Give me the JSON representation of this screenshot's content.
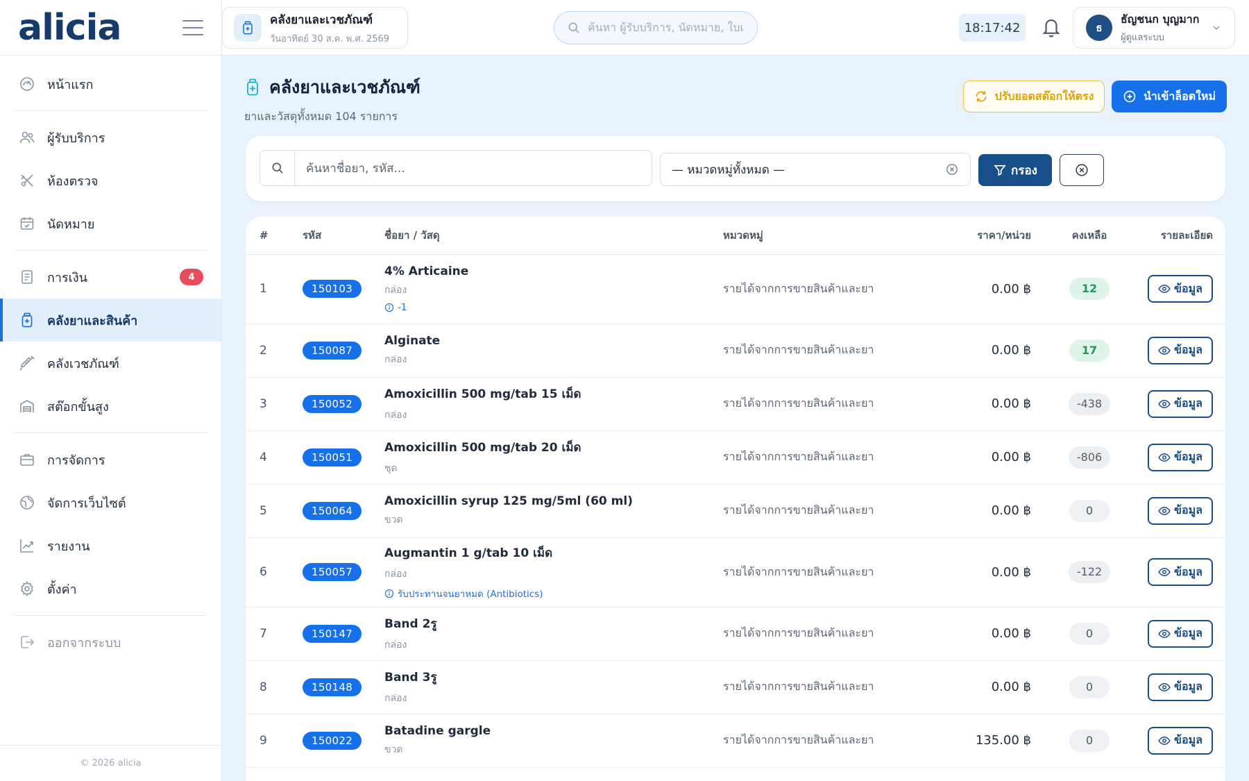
{
  "brand": {
    "logo": "alicia"
  },
  "sidebar": {
    "items": [
      {
        "id": "home",
        "label": "หน้าแรก",
        "icon": "dashboard-icon"
      },
      {
        "id": "patients",
        "label": "ผู้รับบริการ",
        "icon": "users-icon"
      },
      {
        "id": "exam-room",
        "label": "ห้องตรวจ",
        "icon": "tools-icon"
      },
      {
        "id": "appointments",
        "label": "นัดหมาย",
        "icon": "calendar-icon"
      },
      {
        "id": "finance",
        "label": "การเงิน",
        "icon": "receipt-icon",
        "badge": "4"
      },
      {
        "id": "pharmacy",
        "label": "คลังยาและสินค้า",
        "icon": "medicine-bottle-icon",
        "active": true
      },
      {
        "id": "supplies",
        "label": "คลังเวชภัณฑ์",
        "icon": "syringe-icon"
      },
      {
        "id": "advanced-stock",
        "label": "สต๊อกขั้นสูง",
        "icon": "warehouse-icon"
      },
      {
        "id": "management",
        "label": "การจัดการ",
        "icon": "briefcase-icon"
      },
      {
        "id": "website",
        "label": "จัดการเว็บไซต์",
        "icon": "globe-icon"
      },
      {
        "id": "reports",
        "label": "รายงาน",
        "icon": "chart-icon"
      },
      {
        "id": "settings",
        "label": "ตั้งค่า",
        "icon": "gear-icon"
      },
      {
        "id": "logout",
        "label": "ออกจากระบบ",
        "icon": "logout-icon"
      }
    ],
    "footer": "© 2026 alicia"
  },
  "topbar": {
    "page_chip_title": "คลังยาและเวชภัณฑ์",
    "page_chip_date": "วันอาทิตย์ 30 ส.ค. พ.ศ. 2569",
    "search_placeholder": "ค้นหา ผู้รับบริการ, นัดหมาย, ใบเสร็จ...",
    "clock": "18:17:42",
    "user_initial": "ธ",
    "user_name": "ธัญชนก บุญมาก",
    "user_role": "ผู้ดูแลระบบ"
  },
  "page": {
    "title": "คลังยาและเวชภัณฑ์",
    "subtitle": "ยาและวัสดุทั้งหมด 104 รายการ",
    "reconcile_label": "ปรับยอดสต๊อกให้ตรง",
    "import_label": "นำเข้าล็อตใหม่"
  },
  "filters": {
    "search_placeholder": "ค้นหาชื่อยา, รหัส...",
    "category_value": "— หมวดหมู่ทั้งหมด —",
    "filter_label": "กรอง"
  },
  "table": {
    "headers": [
      "#",
      "รหัส",
      "ชื่อยา / วัสดุ",
      "หมวดหมู่",
      "ราคา/หน่วย",
      "คงเหลือ",
      "รายละเอียด"
    ],
    "detail_label": "ข้อมูล",
    "rows": [
      {
        "idx": "1",
        "code": "150103",
        "name": "4% Articaine",
        "unit": "กล่อง",
        "note": "-1",
        "category": "รายได้จากการขายสินค้าและยา",
        "price": "0.00 ฿",
        "stock": "12",
        "stock_type": "pos"
      },
      {
        "idx": "2",
        "code": "150087",
        "name": "Alginate",
        "unit": "กล่อง",
        "note": "",
        "category": "รายได้จากการขายสินค้าและยา",
        "price": "0.00 ฿",
        "stock": "17",
        "stock_type": "pos"
      },
      {
        "idx": "3",
        "code": "150052",
        "name": "Amoxicillin 500 mg/tab 15 เม็ด",
        "unit": "กล่อง",
        "note": "",
        "category": "รายได้จากการขายสินค้าและยา",
        "price": "0.00 ฿",
        "stock": "-438",
        "stock_type": "neg"
      },
      {
        "idx": "4",
        "code": "150051",
        "name": "Amoxicillin 500 mg/tab 20 เม็ด",
        "unit": "ชุด",
        "note": "",
        "category": "รายได้จากการขายสินค้าและยา",
        "price": "0.00 ฿",
        "stock": "-806",
        "stock_type": "neg"
      },
      {
        "idx": "5",
        "code": "150064",
        "name": "Amoxicillin syrup 125 mg/5ml (60 ml)",
        "unit": "ขวด",
        "note": "",
        "category": "รายได้จากการขายสินค้าและยา",
        "price": "0.00 ฿",
        "stock": "0",
        "stock_type": "zero"
      },
      {
        "idx": "6",
        "code": "150057",
        "name": "Augmantin 1 g/tab 10 เม็ด",
        "unit": "กล่อง",
        "note": "รับประทานจนยาหมด (Antibiotics)",
        "category": "รายได้จากการขายสินค้าและยา",
        "price": "0.00 ฿",
        "stock": "-122",
        "stock_type": "neg"
      },
      {
        "idx": "7",
        "code": "150147",
        "name": "Band 2รู",
        "unit": "กล่อง",
        "note": "",
        "category": "รายได้จากการขายสินค้าและยา",
        "price": "0.00 ฿",
        "stock": "0",
        "stock_type": "zero"
      },
      {
        "idx": "8",
        "code": "150148",
        "name": "Band 3รู",
        "unit": "กล่อง",
        "note": "",
        "category": "รายได้จากการขายสินค้าและยา",
        "price": "0.00 ฿",
        "stock": "0",
        "stock_type": "zero"
      },
      {
        "idx": "9",
        "code": "150022",
        "name": "Batadine gargle",
        "unit": "ขวด",
        "note": "",
        "category": "รายได้จากการขายสินค้าและยา",
        "price": "135.00 ฿",
        "stock": "0",
        "stock_type": "zero"
      }
    ]
  },
  "colors": {
    "brand": "#163a6a",
    "accent": "#1670ea",
    "warning": "#f2c236",
    "badge": "#e84c5a",
    "success": "#22995a"
  }
}
